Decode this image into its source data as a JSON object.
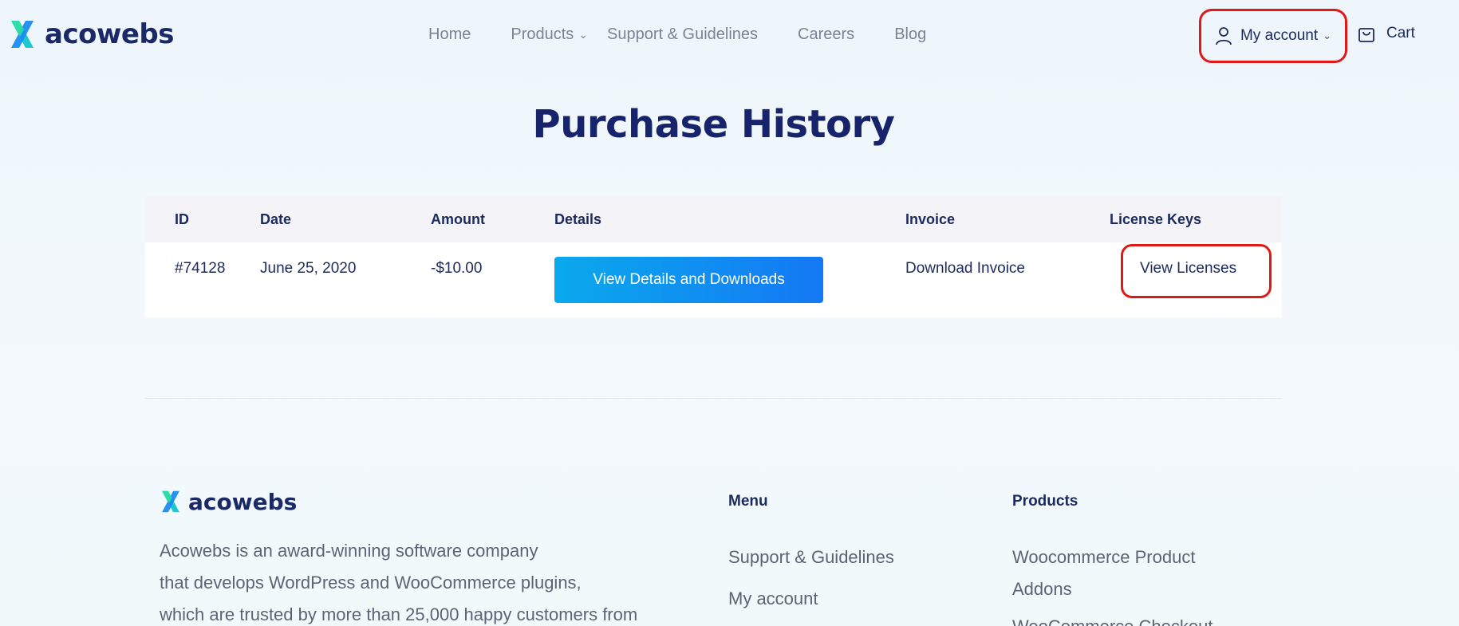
{
  "brand": {
    "name": "acowebs",
    "accent": "#1478f5",
    "navy": "#17236b",
    "highlight": "#e01818"
  },
  "nav": {
    "items": [
      {
        "label": "Home"
      },
      {
        "label": "Products",
        "has_dropdown": true
      },
      {
        "label": "Support & Guidelines"
      },
      {
        "label": "Careers"
      },
      {
        "label": "Blog"
      }
    ],
    "account_label": "My account",
    "cart_label": "Cart"
  },
  "page": {
    "title": "Purchase History"
  },
  "table": {
    "headers": {
      "id": "ID",
      "date": "Date",
      "amount": "Amount",
      "details": "Details",
      "invoice": "Invoice",
      "license": "License Keys"
    },
    "rows": [
      {
        "id": "#74128",
        "date": "June 25, 2020",
        "amount": "-$10.00",
        "details_button": "View Details and Downloads",
        "invoice_link": "Download Invoice",
        "license_link": "View Licenses"
      }
    ]
  },
  "footer": {
    "brand_name": "acowebs",
    "description": [
      "Acowebs is an award-winning software company",
      "that develops WordPress and WooCommerce plugins,",
      "which are trusted by more than 25,000 happy customers from"
    ],
    "menu": {
      "title": "Menu",
      "links": [
        "Support & Guidelines",
        "My account"
      ]
    },
    "products": {
      "title": "Products",
      "links": [
        "Woocommerce Product",
        "Addons",
        "WooCommerce Checkout"
      ]
    }
  }
}
